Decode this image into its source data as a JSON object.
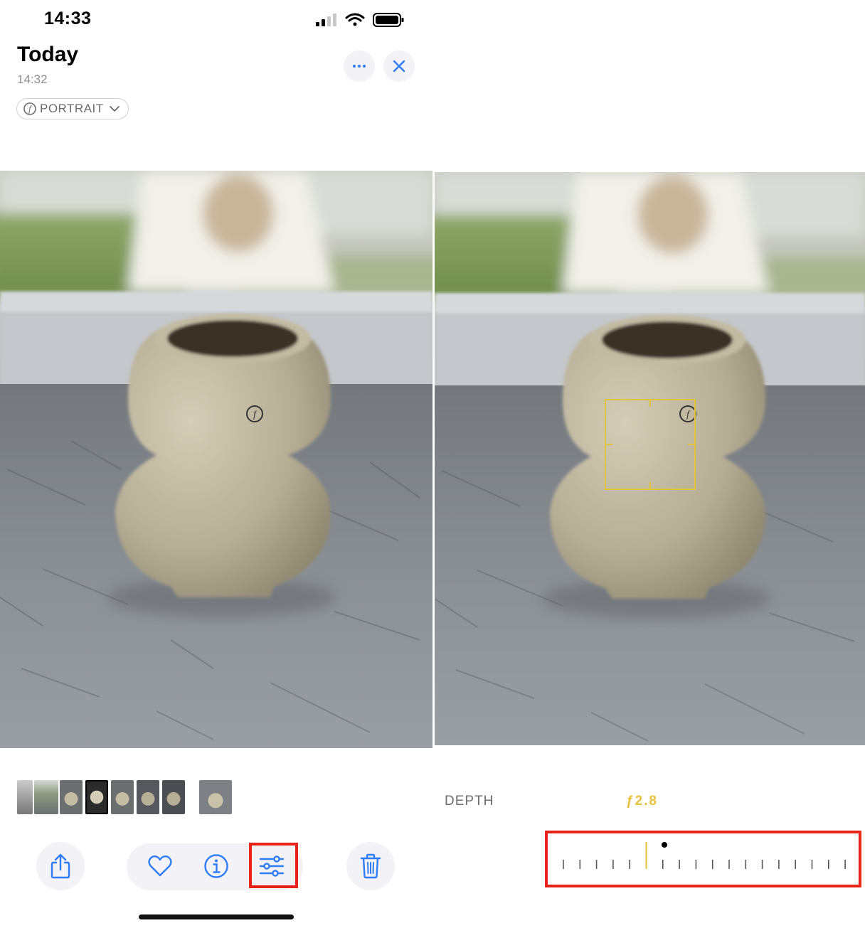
{
  "status_bar": {
    "time": "14:33"
  },
  "header": {
    "title": "Today",
    "subtitle": "14:32",
    "mode_pill": "PORTRAIT"
  },
  "icons": {
    "more": "ellipsis-icon",
    "close": "close-icon",
    "share": "share-icon",
    "favorite": "heart-icon",
    "info": "info-icon",
    "adjust": "sliders-icon",
    "delete": "trash-icon"
  },
  "depth": {
    "label": "DEPTH",
    "value": "ƒ2.8"
  },
  "colors": {
    "accent": "#2f7cf6",
    "highlight": "#e8231b",
    "depth_yellow": "#e6c13c"
  }
}
